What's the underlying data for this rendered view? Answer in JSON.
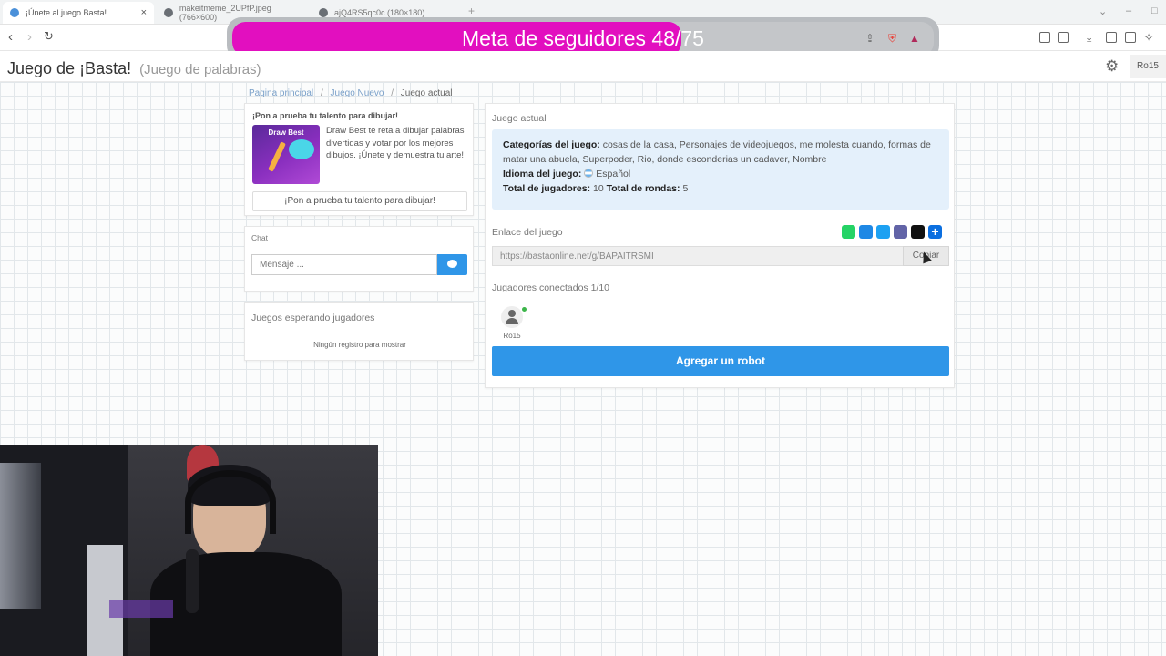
{
  "browser": {
    "tabs": [
      {
        "title": "¡Únete al juego Basta!",
        "active": true
      },
      {
        "title": "makeitmeme_2UPfP.jpeg (766×600)",
        "active": false
      },
      {
        "title": "ajQ4RS5qc0c (180×180)",
        "active": false
      }
    ],
    "close_glyph": "×",
    "new_tab_glyph": "+"
  },
  "overlay": {
    "text": "Meta de seguidores 48/75",
    "current": 48,
    "goal": 75,
    "fill_color": "#e20fbf"
  },
  "header": {
    "title": "Juego de ¡Basta!",
    "subtitle": "(Juego de palabras)",
    "user": "Ro15"
  },
  "breadcrumb": {
    "home": "Pagina principal",
    "new_game": "Juego Nuevo",
    "current": "Juego actual",
    "separator": "/"
  },
  "promo": {
    "heading": "¡Pon a prueba tu talento para dibujar!",
    "image_title": "Draw Best",
    "description": "Draw Best te reta a dibujar palabras divertidas y votar por los mejores dibujos. ¡Únete y demuestra tu arte!",
    "button_label": "¡Pon a prueba tu talento para dibujar!"
  },
  "chat": {
    "title": "Chat",
    "input_placeholder": "Mensaje ..."
  },
  "waiting_games": {
    "title": "Juegos esperando jugadores",
    "empty_text": "Ningún registro para mostrar"
  },
  "game": {
    "title": "Juego actual",
    "categories_label": "Categorías del juego:",
    "categories_value": "cosas de la casa, Personajes de videojuegos, me molesta cuando, formas de matar una abuela, Superpoder, Rio, donde esconderias un cadaver, Nombre",
    "language_label": "Idioma del juego:",
    "language_value": "Español",
    "players_total_label": "Total de jugadores:",
    "players_total_value": "10",
    "rounds_label": "Total de rondas:",
    "rounds_value": "5",
    "link_label": "Enlace del juego",
    "link_value": "https://bastaonline.net/g/BAPAITRSMI",
    "copy_label": "Copiar",
    "connected_label": "Jugadores conectados 1/10",
    "player_name": "Ro15",
    "add_robot_label": "Agregar un robot",
    "share_icons": [
      "whatsapp-icon",
      "messenger-icon",
      "twitter-icon",
      "teams-icon",
      "snapchat-icon",
      "add-share-icon"
    ]
  },
  "colors": {
    "accent": "#2f96e8",
    "overlay_pink": "#e20fbf",
    "info_bg": "#e4f0fb"
  }
}
